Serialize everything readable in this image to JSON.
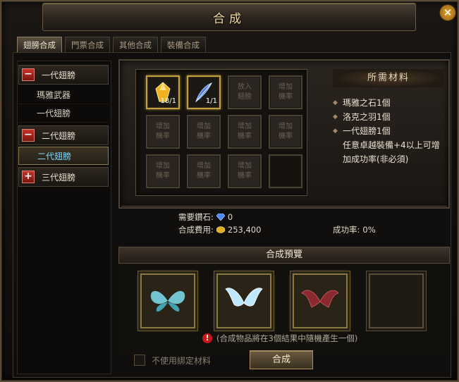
{
  "window": {
    "title": "合成",
    "close_glyph": "✕"
  },
  "tabs": [
    {
      "label": "翅膀合成",
      "active": true
    },
    {
      "label": "門票合成",
      "active": false
    },
    {
      "label": "其他合成",
      "active": false
    },
    {
      "label": "裝備合成",
      "active": false
    }
  ],
  "sidebar": {
    "categories": [
      {
        "label": "一代翅膀",
        "toggle": "−",
        "items": [
          "瑪雅武器",
          "一代翅膀"
        ]
      },
      {
        "label": "二代翅膀",
        "toggle": "−",
        "items": [
          "二代翅膀"
        ]
      },
      {
        "label": "三代翅膀",
        "toggle": "+",
        "items": []
      }
    ],
    "selected_item": "二代翅膀"
  },
  "slots": {
    "item1_count": "18/1",
    "item2_count": "1/1",
    "place_wing": [
      "放入",
      "翅膀"
    ],
    "add_rate": [
      "增加",
      "機率"
    ]
  },
  "requirements": {
    "header": "所需材料",
    "items": [
      "瑪雅之石1個",
      "洛克之羽1個",
      "一代翅膀1個"
    ],
    "note": [
      "任意卓越裝備+4以上可增",
      "加成功率(非必須)"
    ]
  },
  "costs": {
    "diamond_label": "需要鑽石:",
    "diamond_value": "0",
    "fee_label": "合成費用:",
    "fee_value": "253,400",
    "rate_label": "成功率:",
    "rate_value": "0%"
  },
  "preview": {
    "header": "合成預覽",
    "warning": "(合成物品將在3個結果中隨機產生一個)"
  },
  "footer": {
    "checkbox_label": "不使用綁定材料",
    "combine_button": "合成"
  },
  "colors": {
    "accent_gold": "#c0a040",
    "toggle_red": "#c8342a",
    "selected_text": "#7fd8ff"
  }
}
